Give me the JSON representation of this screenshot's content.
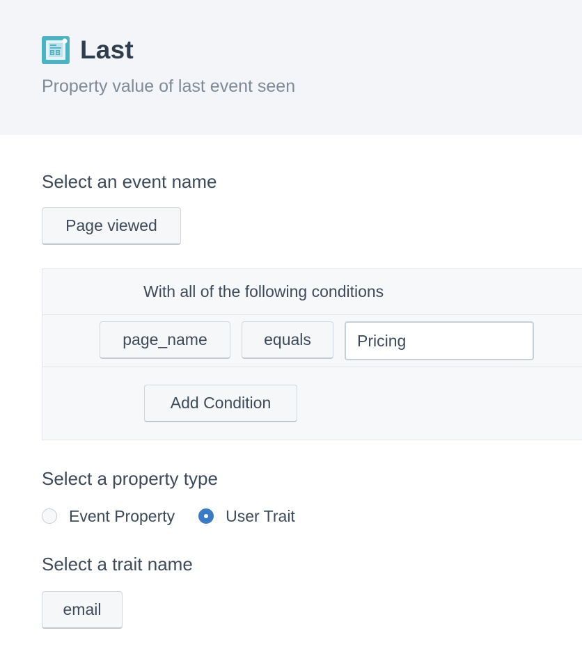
{
  "header": {
    "title": "Last",
    "subtitle": "Property value of last event seen",
    "icon": "document-list-icon",
    "icon_color": "#4ab3c4"
  },
  "event_section": {
    "label": "Select an event name",
    "selected_event": "Page viewed"
  },
  "conditions": {
    "heading": "With all of the following conditions",
    "rows": [
      {
        "property": "page_name",
        "operator": "equals",
        "value": "Pricing"
      }
    ],
    "add_label": "Add Condition"
  },
  "property_type": {
    "label": "Select a property type",
    "options": [
      {
        "label": "Event Property",
        "selected": false
      },
      {
        "label": "User Trait",
        "selected": true
      }
    ],
    "accent_color": "#3a7bc8"
  },
  "trait_section": {
    "label": "Select a trait name",
    "selected_trait": "email"
  }
}
